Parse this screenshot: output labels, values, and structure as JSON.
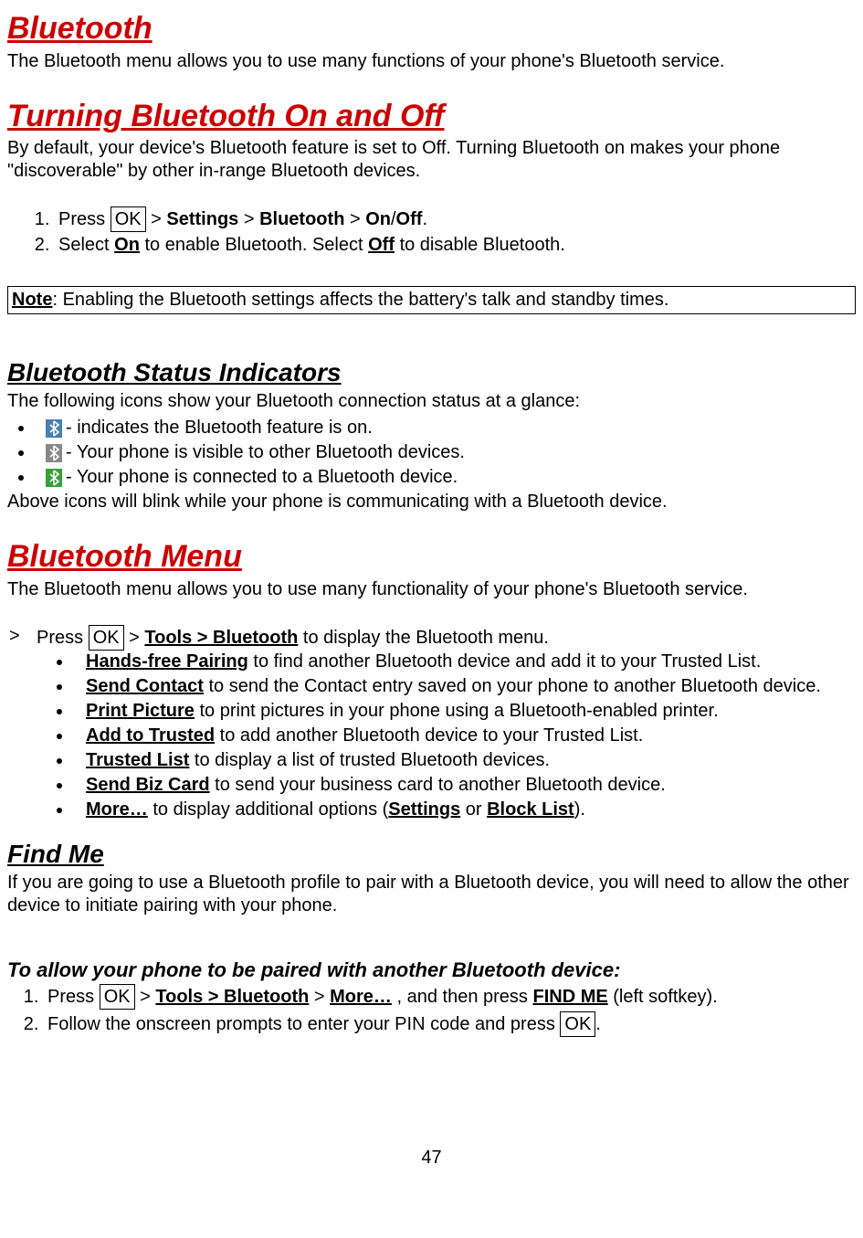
{
  "s1": {
    "title": "Bluetooth",
    "intro": "The Bluetooth menu allows you to use many functions of your phone's Bluetooth service."
  },
  "s2": {
    "title": "Turning Bluetooth On and Off",
    "intro": "By default, your device's Bluetooth feature is set to Off. Turning Bluetooth on makes your phone \"discoverable\" by other in-range Bluetooth devices.",
    "step1_pre": "Press ",
    "step1_ok": "OK",
    "step1_gt1": " > ",
    "step1_settings": "Settings",
    "step1_gt2": " > ",
    "step1_bluetooth": "Bluetooth",
    "step1_gt3": " > ",
    "step1_on": "On",
    "step1_slash": "/",
    "step1_off": "Off",
    "step1_end": ".",
    "step2_pre": "Select ",
    "step2_on": "On",
    "step2_mid": " to enable Bluetooth. Select ",
    "step2_off": "Off",
    "step2_end": " to disable Bluetooth.",
    "note_label": "Note",
    "note_text": ": Enabling the Bluetooth settings affects the battery's talk and standby times."
  },
  "s3": {
    "title": "Bluetooth Status Indicators",
    "intro": "The following icons show your Bluetooth connection status at a glance:",
    "r1": " - indicates the Bluetooth feature is on.",
    "r2": " - Your phone is visible to other Bluetooth devices.",
    "r3": " - Your phone is connected to a Bluetooth device.",
    "outro": "Above icons will blink while your phone is communicating with a Bluetooth device."
  },
  "s4": {
    "title": "Bluetooth Menu",
    "intro": "The Bluetooth menu allows you to use many functionality of your phone's Bluetooth service.",
    "lead_gt": ">",
    "lead_pre": "Press ",
    "lead_ok": "OK",
    "lead_gt2": " > ",
    "lead_tools": "Tools > Bluetooth",
    "lead_end": " to display the Bluetooth menu.",
    "items": [
      {
        "b": "Hands-free Pairing",
        "t": " to find another Bluetooth device and add it to your Trusted List."
      },
      {
        "b": "Send Contact",
        "t": " to send the Contact entry saved on your phone to another Bluetooth device."
      },
      {
        "b": "Print Picture",
        "t": " to print pictures in your phone using a Bluetooth-enabled printer."
      },
      {
        "b": "Add to Trusted",
        "t": " to add another Bluetooth device to your Trusted List."
      },
      {
        "b": "Trusted List",
        "t": " to display a list of trusted Bluetooth devices."
      },
      {
        "b": "Send Biz Card",
        "t": " to send your business card to another Bluetooth device."
      },
      {
        "b": "More…",
        "t_pre": " to display additional options (",
        "t_b1": "Settings",
        "t_mid": " or ",
        "t_b2": "Block List",
        "t_end": ")."
      }
    ]
  },
  "s5": {
    "title": "Find Me",
    "intro": "If you are going to use a Bluetooth profile to pair with a Bluetooth device, you will need to allow the other device to initiate pairing with your phone.",
    "sub": "To allow your phone to be paired with another Bluetooth device:",
    "step1_pre": "Press ",
    "step1_ok": "OK",
    "step1_gt": " > ",
    "step1_tools": "Tools > Bluetooth",
    "step1_gt2": " > ",
    "step1_more": "More…",
    "step1_mid": " , and then press ",
    "step1_find": "FIND ME",
    "step1_end": " (left softkey).",
    "step2_pre": "Follow the onscreen prompts to enter your PIN code and press ",
    "step2_ok": "OK",
    "step2_end": "."
  },
  "page": "47"
}
